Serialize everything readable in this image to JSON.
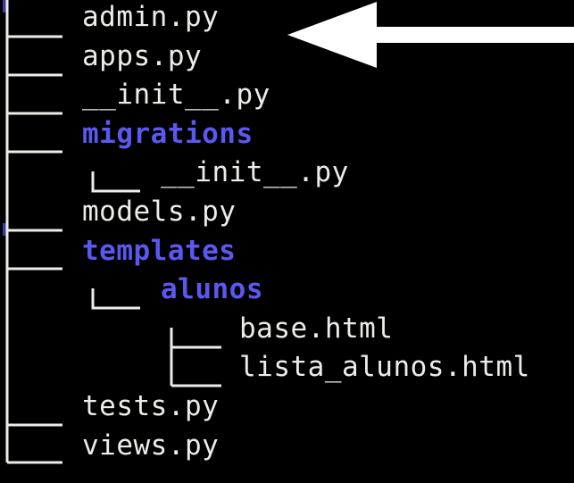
{
  "colors": {
    "background": "#000000",
    "file_text": "#ecece8",
    "directory_text": "#5a58f0",
    "connector_lines": "#ecece8",
    "arrow": "#ffffff"
  },
  "arrow_icon": "arrow-left-icon",
  "tree": [
    {
      "name": "admin.py",
      "type": "file",
      "depth": 0
    },
    {
      "name": "apps.py",
      "type": "file",
      "depth": 0
    },
    {
      "name": "__init__.py",
      "type": "file",
      "depth": 0
    },
    {
      "name": "migrations",
      "type": "directory",
      "depth": 0
    },
    {
      "name": "__init__.py",
      "type": "file",
      "depth": 1
    },
    {
      "name": "models.py",
      "type": "file",
      "depth": 0
    },
    {
      "name": "templates",
      "type": "directory",
      "depth": 0
    },
    {
      "name": "alunos",
      "type": "directory",
      "depth": 1
    },
    {
      "name": "base.html",
      "type": "file",
      "depth": 2
    },
    {
      "name": "lista_alunos.html",
      "type": "file",
      "depth": 2
    },
    {
      "name": "tests.py",
      "type": "file",
      "depth": 0
    },
    {
      "name": "views.py",
      "type": "file",
      "depth": 0
    }
  ]
}
